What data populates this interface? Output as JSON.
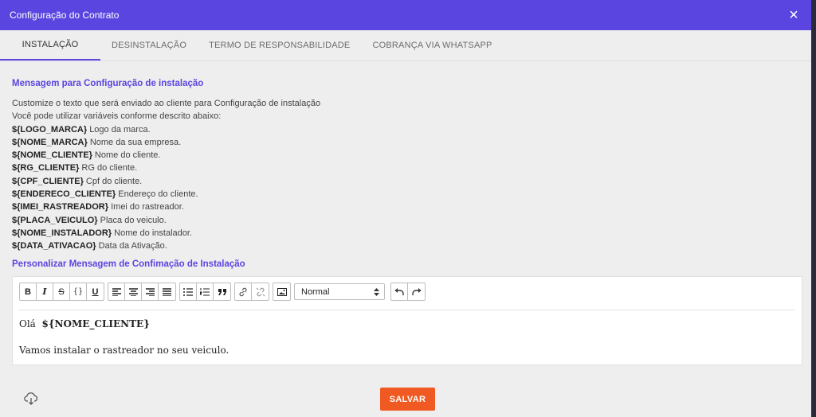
{
  "header": {
    "title": "Configuração do Contrato",
    "close_glyph": "×"
  },
  "tabs": [
    {
      "label": "INSTALAÇÃO",
      "active": true
    },
    {
      "label": "DESINSTALAÇÃO",
      "active": false
    },
    {
      "label": "TERMO DE RESPONSABILIDADE",
      "active": false
    },
    {
      "label": "COBRANÇA VIA WHATSAPP",
      "active": false
    }
  ],
  "main": {
    "section_title": "Mensagem para Configuração de instalação",
    "desc_line1": "Customize o texto que será enviado ao cliente para Configuração de instalação",
    "desc_line2": "Você pode utilizar variáveis conforme descrito abaixo:",
    "variables": [
      {
        "name": "${LOGO_MARCA}",
        "desc": "Logo da marca."
      },
      {
        "name": "${NOME_MARCA}",
        "desc": "Nome da sua empresa."
      },
      {
        "name": "${NOME_CLIENTE}",
        "desc": "Nome do cliente."
      },
      {
        "name": "${RG_CLIENTE}",
        "desc": "RG do cliente."
      },
      {
        "name": "${CPF_CLIENTE}",
        "desc": "Cpf do cliente."
      },
      {
        "name": "${ENDERECO_CLIENTE}",
        "desc": "Endereço do cliente."
      },
      {
        "name": "${IMEI_RASTREADOR}",
        "desc": "Imei do rastreador."
      },
      {
        "name": "${PLACA_VEICULO}",
        "desc": "Placa do veiculo."
      },
      {
        "name": "${NOME_INSTALADOR}",
        "desc": "Nome do instalador."
      },
      {
        "name": "${DATA_ATIVACAO}",
        "desc": "Data da Ativação."
      }
    ],
    "section_title2": "Personalizar Mensagem de Confimação de Instalação"
  },
  "editor": {
    "toolbar": {
      "bold": "B",
      "italic": "I",
      "strike": "S",
      "code": "{ }",
      "underline": "U",
      "heading_value": "Normal"
    },
    "content": {
      "greeting": "Olá",
      "variable": "${NOME_CLIENTE}",
      "body": "Vamos instalar o rastreador no seu veiculo."
    }
  },
  "footer": {
    "save_label": "SALVAR"
  },
  "colors": {
    "primary": "#5b45e0",
    "save_button": "#f05a22"
  }
}
